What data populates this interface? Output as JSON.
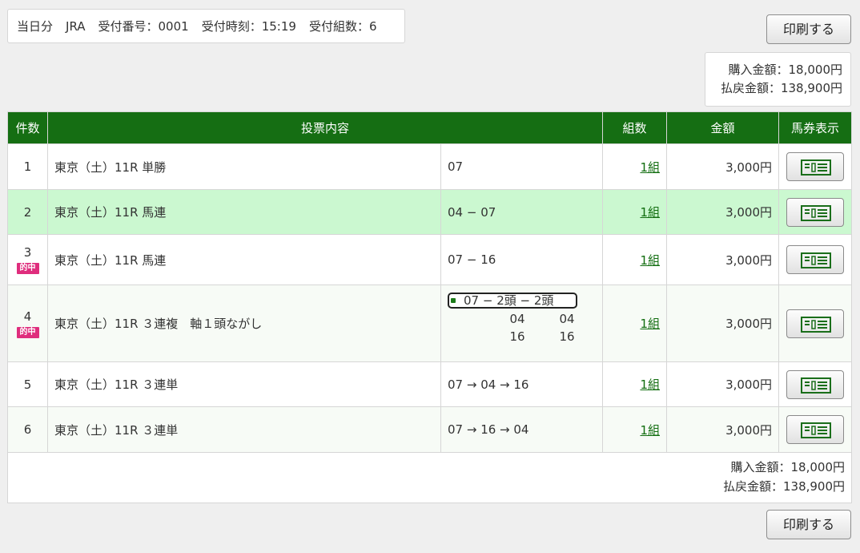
{
  "info": {
    "items": [
      "当日分",
      "JRA",
      "受付番号：0001",
      "受付時刻：15:19",
      "受付組数：6"
    ]
  },
  "buttons": {
    "print_label": "印刷する"
  },
  "summary": {
    "purchase": "購入金額：18,000円",
    "refund": "払戻金額：138,900円"
  },
  "table": {
    "headers": {
      "num": "件数",
      "content": "投票内容",
      "count": "組数",
      "amount": "金額",
      "ticket": "馬券表示"
    },
    "hit_label": "的中",
    "rows": [
      {
        "num": "1",
        "race": "東京（土）11R 単勝",
        "combo": "07",
        "count": "1組",
        "amount": "3,000円",
        "hit": false
      },
      {
        "num": "2",
        "race": "東京（土）11R 馬連",
        "combo": "04 − 07",
        "count": "1組",
        "amount": "3,000円",
        "hit": false
      },
      {
        "num": "3",
        "race": "東京（土）11R 馬連",
        "combo": "07 − 16",
        "count": "1組",
        "amount": "3,000円",
        "hit": true
      },
      {
        "num": "4",
        "race": "東京（土）11R ３連複　軸１頭ながし",
        "combo": "07 − 2頭 − 2頭",
        "combo_col1": [
          "04",
          "16"
        ],
        "combo_col2": [
          "04",
          "16"
        ],
        "count": "1組",
        "amount": "3,000円",
        "hit": true
      },
      {
        "num": "5",
        "race": "東京（土）11R ３連単",
        "combo": "07 → 04 → 16",
        "count": "1組",
        "amount": "3,000円",
        "hit": false
      },
      {
        "num": "6",
        "race": "東京（土）11R ３連単",
        "combo": "07 → 16 → 04",
        "count": "1組",
        "amount": "3,000円",
        "hit": false
      }
    ]
  },
  "colors": {
    "header_green": "#156e13",
    "highlight_row": "#cbf8d0",
    "hit_badge": "#df2d7d",
    "link_green": "#116d0f"
  },
  "icons": {
    "ticket_icon": "betting-ticket-icon"
  }
}
